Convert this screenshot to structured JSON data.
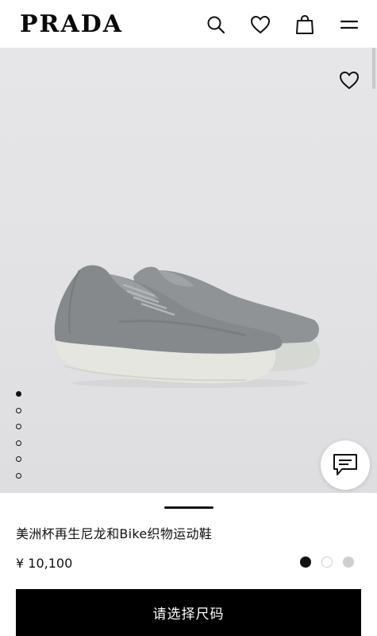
{
  "header": {
    "brand": "PRADA",
    "icons": [
      "search-icon",
      "heart-icon",
      "shopping-bag-icon",
      "menu-icon"
    ]
  },
  "gallery": {
    "image": "gray-sneaker",
    "dots_count": 6,
    "active_dot": 1
  },
  "product": {
    "title": "美洲杯再生尼龙和Bike织物运动鞋",
    "price": "¥ 10,100",
    "swatches": [
      {
        "color": "#111111",
        "selected": true
      },
      {
        "color": "#ffffff",
        "selected": false
      },
      {
        "color": "#cfcfcf",
        "selected": false
      }
    ]
  },
  "cta": {
    "label": "请选择尺码"
  },
  "colors": {
    "accent": "#000000",
    "text": "#111111",
    "hero_bg": "#e4e4e6"
  }
}
